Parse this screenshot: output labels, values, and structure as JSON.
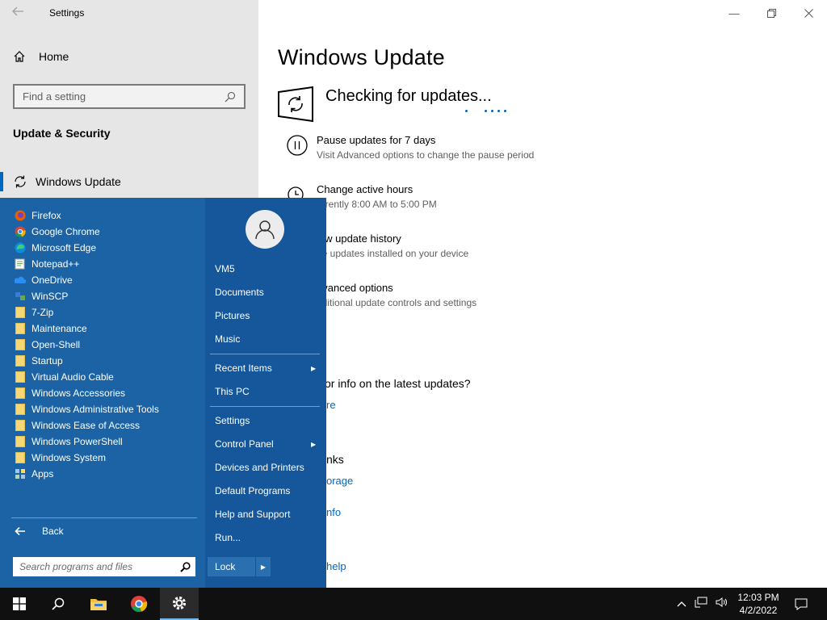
{
  "window": {
    "title": "Settings",
    "home_label": "Home",
    "search_placeholder": "Find a setting",
    "section": "Update & Security",
    "active_nav": "Windows Update"
  },
  "main": {
    "title": "Windows Update",
    "status": "Checking for updates...",
    "options": [
      {
        "title": "Pause updates for 7 days",
        "subtitle": "Visit Advanced options to change the pause period"
      },
      {
        "title": "Change active hours",
        "subtitle": "urrently 8:00 AM to 5:00 PM"
      },
      {
        "title": "iew update history",
        "subtitle": "ee updates installed on your device"
      },
      {
        "title": "dvanced options",
        "subtitle": "dditional update controls and settings"
      }
    ],
    "info_heading": "or info on the latest updates?",
    "info_link": "re",
    "links_heading": "nks",
    "links": [
      "orage",
      "nfo",
      "help"
    ]
  },
  "start_menu": {
    "programs": [
      {
        "label": "Firefox",
        "icon": "firefox-icon"
      },
      {
        "label": "Google Chrome",
        "icon": "chrome-icon"
      },
      {
        "label": "Microsoft Edge",
        "icon": "edge-icon"
      },
      {
        "label": "Notepad++",
        "icon": "notepadpp-icon"
      },
      {
        "label": "OneDrive",
        "icon": "onedrive-icon"
      },
      {
        "label": "WinSCP",
        "icon": "winscp-icon"
      },
      {
        "label": "7-Zip",
        "icon": "folder-icon"
      },
      {
        "label": "Maintenance",
        "icon": "folder-icon"
      },
      {
        "label": "Open-Shell",
        "icon": "folder-icon"
      },
      {
        "label": "Startup",
        "icon": "folder-icon"
      },
      {
        "label": "Virtual Audio Cable",
        "icon": "folder-icon"
      },
      {
        "label": "Windows Accessories",
        "icon": "folder-icon"
      },
      {
        "label": "Windows Administrative Tools",
        "icon": "folder-icon"
      },
      {
        "label": "Windows Ease of Access",
        "icon": "folder-icon"
      },
      {
        "label": "Windows PowerShell",
        "icon": "folder-icon"
      },
      {
        "label": "Windows System",
        "icon": "folder-icon"
      },
      {
        "label": "Apps",
        "icon": "apps-icon"
      }
    ],
    "back_label": "Back",
    "search_placeholder": "Search programs and files",
    "right_items": {
      "user": "VM5",
      "documents": "Documents",
      "pictures": "Pictures",
      "music": "Music",
      "recent": "Recent Items",
      "this_pc": "This PC",
      "settings": "Settings",
      "control_panel": "Control Panel",
      "devices": "Devices and Printers",
      "default_programs": "Default Programs",
      "help": "Help and Support",
      "run": "Run..."
    },
    "lock_label": "Lock"
  },
  "taskbar": {
    "time": "12:03 PM",
    "date": "4/2/2022"
  }
}
